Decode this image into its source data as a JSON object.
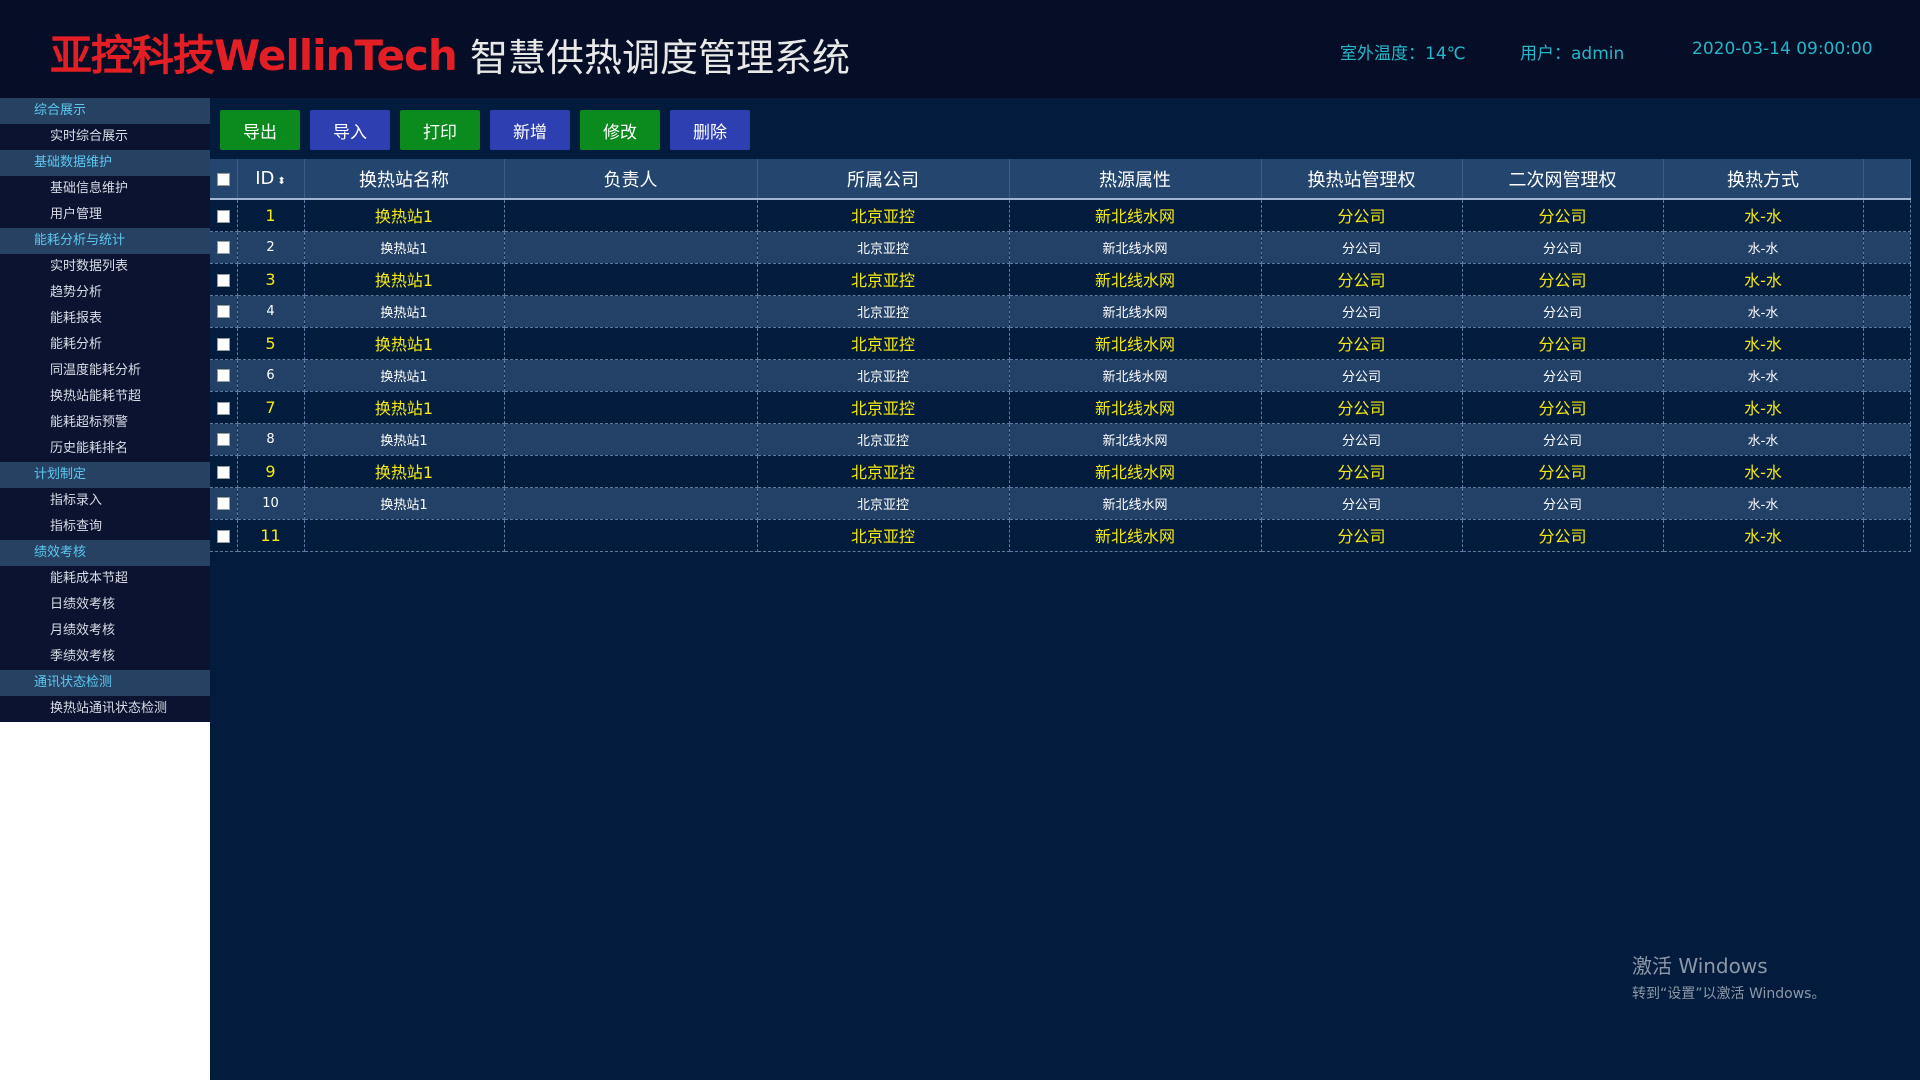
{
  "header": {
    "logo_text": "亚控科技WellinTech",
    "system_title": "智慧供热调度管理系统",
    "outdoor_temp": "室外温度：14℃",
    "user": "用户：admin",
    "datetime": "2020-03-14 09:00:00"
  },
  "sidebar": {
    "groups": [
      {
        "label": "综合展示",
        "items": [
          "实时综合展示"
        ]
      },
      {
        "label": "基础数据维护",
        "items": [
          "基础信息维护",
          "用户管理"
        ]
      },
      {
        "label": "能耗分析与统计",
        "items": [
          "实时数据列表",
          "趋势分析",
          "能耗报表",
          "能耗分析",
          "同温度能耗分析",
          "换热站能耗节超",
          "能耗超标预警",
          "历史能耗排名"
        ]
      },
      {
        "label": "计划制定",
        "items": [
          "指标录入",
          "指标查询"
        ]
      },
      {
        "label": "绩效考核",
        "items": [
          "能耗成本节超",
          "日绩效考核",
          "月绩效考核",
          "季绩效考核"
        ]
      },
      {
        "label": "通讯状态检测",
        "items": [
          "换热站通讯状态检测"
        ]
      }
    ]
  },
  "toolbar": {
    "buttons": [
      {
        "label": "导出",
        "color": "#0b8a1d"
      },
      {
        "label": "导入",
        "color": "#2e3fb2"
      },
      {
        "label": "打印",
        "color": "#0b8a1d"
      },
      {
        "label": "新增",
        "color": "#2e3fb2"
      },
      {
        "label": "修改",
        "color": "#0b8a1d"
      },
      {
        "label": "删除",
        "color": "#2e3fb2"
      }
    ]
  },
  "table": {
    "columns": [
      "ID",
      "换热站名称",
      "负责人",
      "所属公司",
      "热源属性",
      "换热站管理权",
      "二次网管理权",
      "换热方式"
    ],
    "rows": [
      [
        "1",
        "换热站1",
        "",
        "北京亚控",
        "新北线水网",
        "分公司",
        "分公司",
        "水-水"
      ],
      [
        "2",
        "换热站1",
        "",
        "北京亚控",
        "新北线水网",
        "分公司",
        "分公司",
        "水-水"
      ],
      [
        "3",
        "换热站1",
        "",
        "北京亚控",
        "新北线水网",
        "分公司",
        "分公司",
        "水-水"
      ],
      [
        "4",
        "换热站1",
        "",
        "北京亚控",
        "新北线水网",
        "分公司",
        "分公司",
        "水-水"
      ],
      [
        "5",
        "换热站1",
        "",
        "北京亚控",
        "新北线水网",
        "分公司",
        "分公司",
        "水-水"
      ],
      [
        "6",
        "换热站1",
        "",
        "北京亚控",
        "新北线水网",
        "分公司",
        "分公司",
        "水-水"
      ],
      [
        "7",
        "换热站1",
        "",
        "北京亚控",
        "新北线水网",
        "分公司",
        "分公司",
        "水-水"
      ],
      [
        "8",
        "换热站1",
        "",
        "北京亚控",
        "新北线水网",
        "分公司",
        "分公司",
        "水-水"
      ],
      [
        "9",
        "换热站1",
        "",
        "北京亚控",
        "新北线水网",
        "分公司",
        "分公司",
        "水-水"
      ],
      [
        "10",
        "换热站1",
        "",
        "北京亚控",
        "新北线水网",
        "分公司",
        "分公司",
        "水-水"
      ],
      [
        "11",
        "",
        "",
        "北京亚控",
        "新北线水网",
        "分公司",
        "分公司",
        "水-水"
      ]
    ]
  },
  "watermark": {
    "line1": "激活 Windows",
    "line2": "转到“设置”以激活 Windows。"
  }
}
